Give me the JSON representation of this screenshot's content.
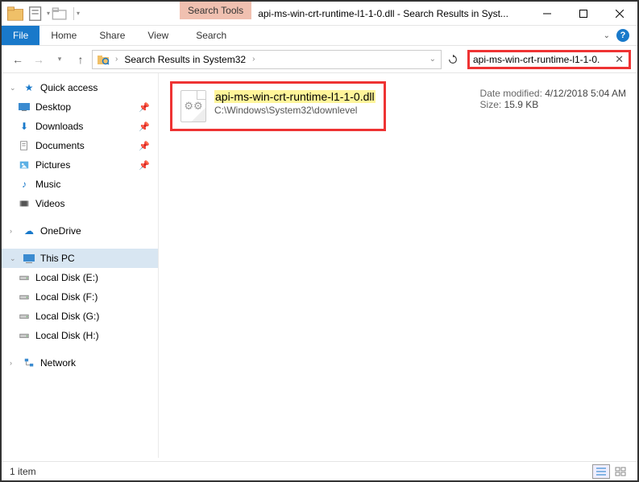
{
  "title": "api-ms-win-crt-runtime-l1-1-0.dll - Search Results in Syst...",
  "context_tab": "Search Tools",
  "ribbon": {
    "file": "File",
    "home": "Home",
    "share": "Share",
    "view": "View",
    "search": "Search"
  },
  "address": {
    "location": "Search Results in System32"
  },
  "search": {
    "query": "api-ms-win-crt-runtime-l1-1-0."
  },
  "sidebar": {
    "quick_access": "Quick access",
    "items_pinned": [
      {
        "label": "Desktop"
      },
      {
        "label": "Downloads"
      },
      {
        "label": "Documents"
      },
      {
        "label": "Pictures"
      }
    ],
    "items": [
      {
        "label": "Music"
      },
      {
        "label": "Videos"
      }
    ],
    "onedrive": "OneDrive",
    "thispc": "This PC",
    "drives": [
      {
        "label": "Local Disk (E:)"
      },
      {
        "label": "Local Disk (F:)"
      },
      {
        "label": "Local Disk (G:)"
      },
      {
        "label": "Local Disk (H:)"
      }
    ],
    "network": "Network"
  },
  "result": {
    "filename": "api-ms-win-crt-runtime-l1-1-0.dll",
    "path": "C:\\Windows\\System32\\downlevel"
  },
  "meta": {
    "date_label": "Date modified:",
    "date_value": "4/12/2018 5:04 AM",
    "size_label": "Size:",
    "size_value": "15.9 KB"
  },
  "status": {
    "count": "1 item"
  }
}
